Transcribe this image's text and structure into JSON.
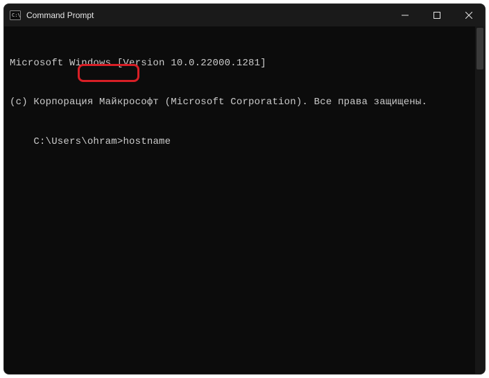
{
  "titlebar": {
    "title": "Command Prompt"
  },
  "terminal": {
    "line1": "Microsoft Windows [Version 10.0.22000.1281]",
    "line2": "(c) Корпорация Майкрософт (Microsoft Corporation). Все права защищены.",
    "prompt_path": "C:\\Users\\ohram",
    "prompt_symbol": ">",
    "command": "hostname"
  }
}
